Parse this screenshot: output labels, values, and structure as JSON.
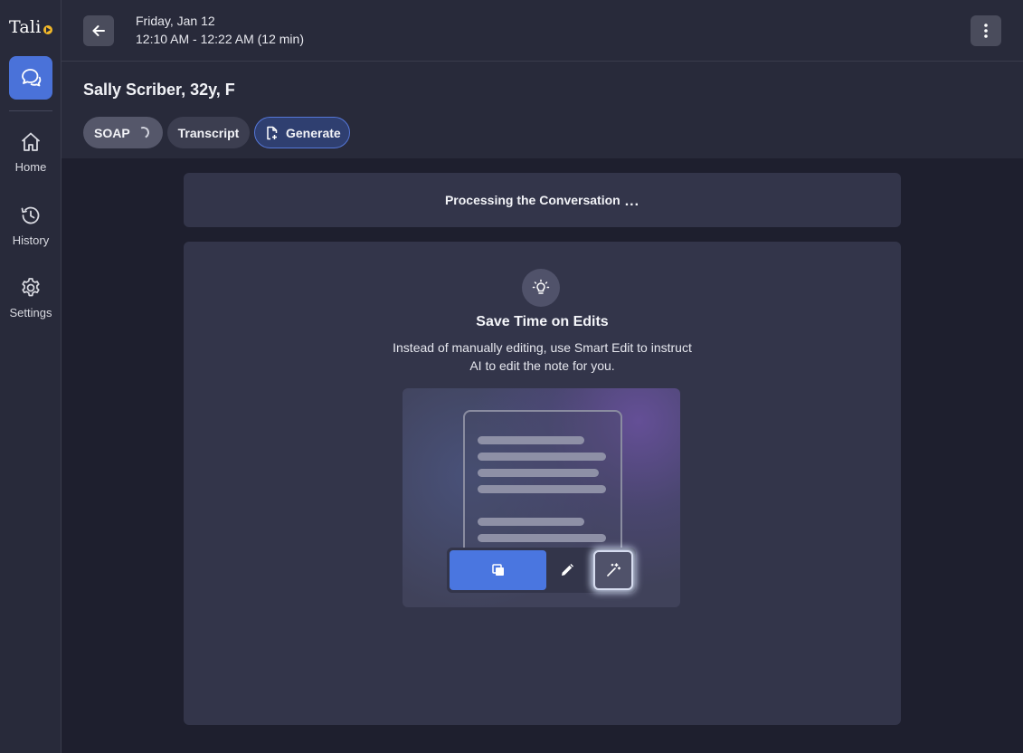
{
  "app": {
    "logo_text": "Tali"
  },
  "sidebar": {
    "items": [
      {
        "label": "Home",
        "icon": "home-icon"
      },
      {
        "label": "History",
        "icon": "history-icon"
      },
      {
        "label": "Settings",
        "icon": "gear-icon"
      }
    ]
  },
  "header": {
    "date": "Friday, Jan 12",
    "time_range": "12:10 AM - 12:22 AM (12 min)"
  },
  "patient": {
    "name": "Sally Scriber, 32y, F"
  },
  "tabs": [
    {
      "label": "SOAP",
      "state": "loading"
    },
    {
      "label": "Transcript"
    },
    {
      "label": "Generate",
      "icon": "document-plus-icon"
    }
  ],
  "processing": {
    "text": "Processing the Conversation",
    "dots": "..."
  },
  "tip": {
    "icon": "lightbulb-icon",
    "title": "Save Time on Edits",
    "body": "Instead of manually editing, use Smart Edit to instruct AI to edit the note for you."
  },
  "colors": {
    "background": "#1e1f2e",
    "panel": "#282a3a",
    "card": "#33354a",
    "accent_blue": "#4a76e0",
    "brand_yellow": "#f2b829"
  }
}
